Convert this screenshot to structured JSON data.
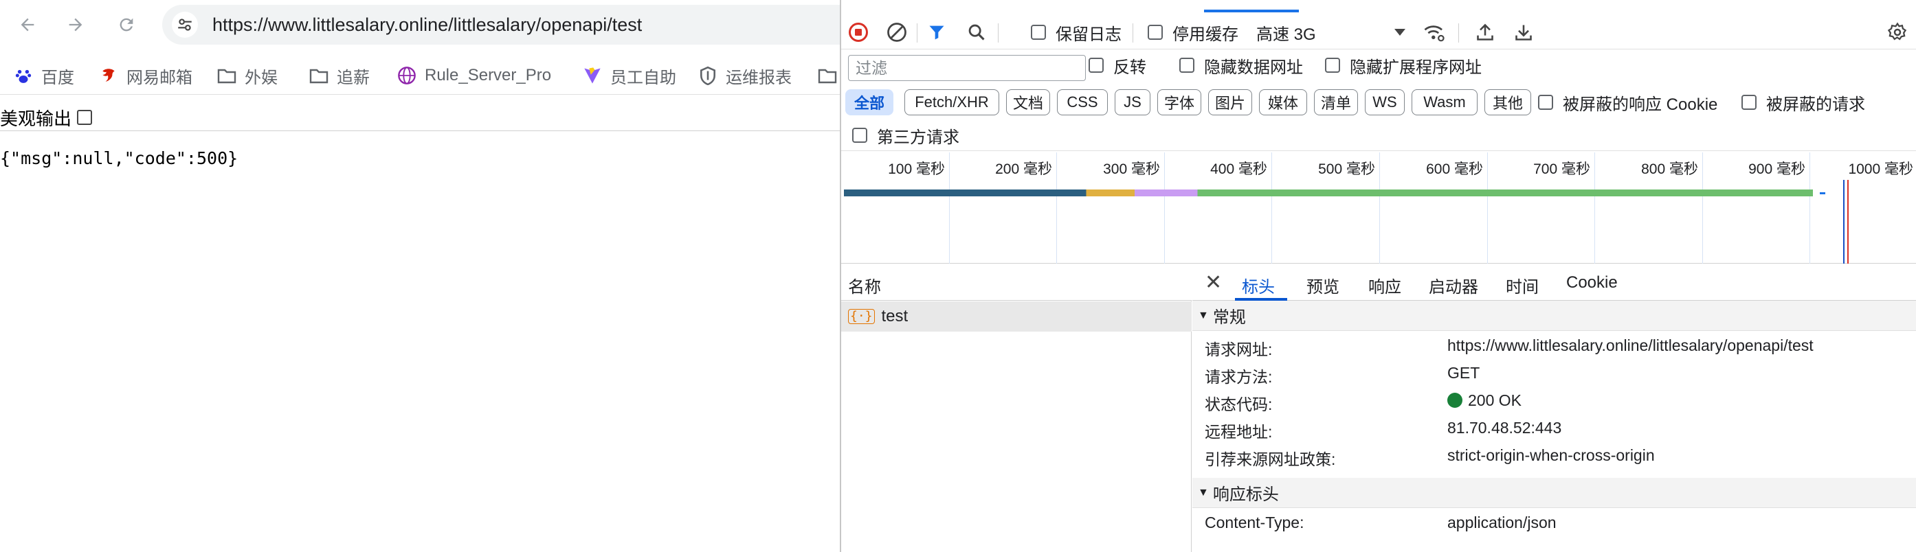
{
  "browser": {
    "url": "https://www.littlesalary.online/littlesalary/openapi/test",
    "bookmarks": [
      {
        "label": "百度",
        "icon": "baidu-paw-icon"
      },
      {
        "label": "网易邮箱",
        "icon": "netease-mail-icon"
      },
      {
        "label": "外娱",
        "icon": "folder-icon"
      },
      {
        "label": "追薪",
        "icon": "folder-icon"
      },
      {
        "label": "Rule_Server_Pro",
        "icon": "globe-icon"
      },
      {
        "label": "员工自助",
        "icon": "vite-logo-icon"
      },
      {
        "label": "运维报表",
        "icon": "shield-icon"
      }
    ],
    "pretty_print_label": "美观输出",
    "response_body": "{\"msg\":null,\"code\":500}"
  },
  "devtools": {
    "toolbar": {
      "preserve_log": "保留日志",
      "disable_cache": "停用缓存",
      "throttling": "高速 3G"
    },
    "filter": {
      "placeholder": "过滤",
      "invert": "反转",
      "hide_data_urls": "隐藏数据网址",
      "hide_extension_urls": "隐藏扩展程序网址"
    },
    "type_filters": [
      "全部",
      "Fetch/XHR",
      "文档",
      "CSS",
      "JS",
      "字体",
      "图片",
      "媒体",
      "清单",
      "WS",
      "Wasm",
      "其他"
    ],
    "blocked_cookies": "被屏蔽的响应 Cookie",
    "blocked_requests": "被屏蔽的请求",
    "third_party": "第三方请求",
    "timeline_ticks": [
      "100 毫秒",
      "200 毫秒",
      "300 毫秒",
      "400 毫秒",
      "500 毫秒",
      "600 毫秒",
      "700 毫秒",
      "800 毫秒",
      "900 毫秒",
      "1000 毫秒"
    ],
    "name_column": "名称",
    "request_name": "test",
    "detail_tabs": [
      "标头",
      "预览",
      "响应",
      "启动器",
      "时间",
      "Cookie"
    ],
    "general": {
      "title": "常规",
      "rows": [
        {
          "key": "请求网址:",
          "value": "https://www.littlesalary.online/littlesalary/openapi/test"
        },
        {
          "key": "请求方法:",
          "value": "GET"
        },
        {
          "key": "状态代码:",
          "value": "200 OK"
        },
        {
          "key": "远程地址:",
          "value": "81.70.48.52:443"
        },
        {
          "key": "引荐来源网址政策:",
          "value": "strict-origin-when-cross-origin"
        }
      ]
    },
    "response_headers": {
      "title": "响应标头",
      "rows": [
        {
          "key": "Content-Type:",
          "value": "application/json"
        }
      ]
    },
    "colors": {
      "accent": "#0b57d0",
      "status_ok": "#188038",
      "record": "#d93025"
    }
  }
}
